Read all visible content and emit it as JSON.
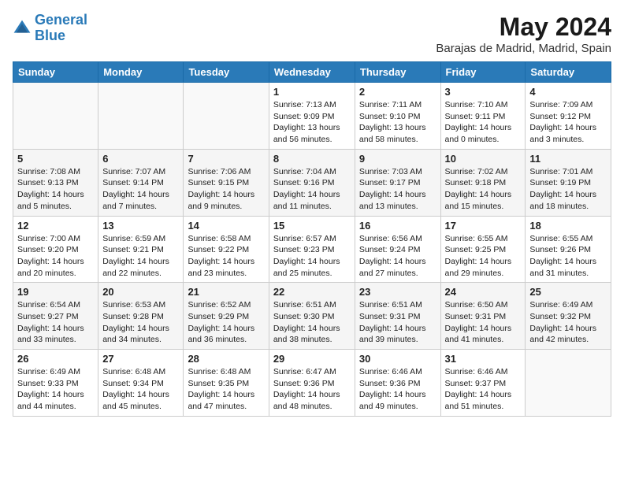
{
  "header": {
    "logo_general": "General",
    "logo_blue": "Blue",
    "month_year": "May 2024",
    "location": "Barajas de Madrid, Madrid, Spain"
  },
  "weekdays": [
    "Sunday",
    "Monday",
    "Tuesday",
    "Wednesday",
    "Thursday",
    "Friday",
    "Saturday"
  ],
  "weeks": [
    [
      {
        "day": "",
        "sunrise": "",
        "sunset": "",
        "daylight": ""
      },
      {
        "day": "",
        "sunrise": "",
        "sunset": "",
        "daylight": ""
      },
      {
        "day": "",
        "sunrise": "",
        "sunset": "",
        "daylight": ""
      },
      {
        "day": "1",
        "sunrise": "Sunrise: 7:13 AM",
        "sunset": "Sunset: 9:09 PM",
        "daylight": "Daylight: 13 hours and 56 minutes."
      },
      {
        "day": "2",
        "sunrise": "Sunrise: 7:11 AM",
        "sunset": "Sunset: 9:10 PM",
        "daylight": "Daylight: 13 hours and 58 minutes."
      },
      {
        "day": "3",
        "sunrise": "Sunrise: 7:10 AM",
        "sunset": "Sunset: 9:11 PM",
        "daylight": "Daylight: 14 hours and 0 minutes."
      },
      {
        "day": "4",
        "sunrise": "Sunrise: 7:09 AM",
        "sunset": "Sunset: 9:12 PM",
        "daylight": "Daylight: 14 hours and 3 minutes."
      }
    ],
    [
      {
        "day": "5",
        "sunrise": "Sunrise: 7:08 AM",
        "sunset": "Sunset: 9:13 PM",
        "daylight": "Daylight: 14 hours and 5 minutes."
      },
      {
        "day": "6",
        "sunrise": "Sunrise: 7:07 AM",
        "sunset": "Sunset: 9:14 PM",
        "daylight": "Daylight: 14 hours and 7 minutes."
      },
      {
        "day": "7",
        "sunrise": "Sunrise: 7:06 AM",
        "sunset": "Sunset: 9:15 PM",
        "daylight": "Daylight: 14 hours and 9 minutes."
      },
      {
        "day": "8",
        "sunrise": "Sunrise: 7:04 AM",
        "sunset": "Sunset: 9:16 PM",
        "daylight": "Daylight: 14 hours and 11 minutes."
      },
      {
        "day": "9",
        "sunrise": "Sunrise: 7:03 AM",
        "sunset": "Sunset: 9:17 PM",
        "daylight": "Daylight: 14 hours and 13 minutes."
      },
      {
        "day": "10",
        "sunrise": "Sunrise: 7:02 AM",
        "sunset": "Sunset: 9:18 PM",
        "daylight": "Daylight: 14 hours and 15 minutes."
      },
      {
        "day": "11",
        "sunrise": "Sunrise: 7:01 AM",
        "sunset": "Sunset: 9:19 PM",
        "daylight": "Daylight: 14 hours and 18 minutes."
      }
    ],
    [
      {
        "day": "12",
        "sunrise": "Sunrise: 7:00 AM",
        "sunset": "Sunset: 9:20 PM",
        "daylight": "Daylight: 14 hours and 20 minutes."
      },
      {
        "day": "13",
        "sunrise": "Sunrise: 6:59 AM",
        "sunset": "Sunset: 9:21 PM",
        "daylight": "Daylight: 14 hours and 22 minutes."
      },
      {
        "day": "14",
        "sunrise": "Sunrise: 6:58 AM",
        "sunset": "Sunset: 9:22 PM",
        "daylight": "Daylight: 14 hours and 23 minutes."
      },
      {
        "day": "15",
        "sunrise": "Sunrise: 6:57 AM",
        "sunset": "Sunset: 9:23 PM",
        "daylight": "Daylight: 14 hours and 25 minutes."
      },
      {
        "day": "16",
        "sunrise": "Sunrise: 6:56 AM",
        "sunset": "Sunset: 9:24 PM",
        "daylight": "Daylight: 14 hours and 27 minutes."
      },
      {
        "day": "17",
        "sunrise": "Sunrise: 6:55 AM",
        "sunset": "Sunset: 9:25 PM",
        "daylight": "Daylight: 14 hours and 29 minutes."
      },
      {
        "day": "18",
        "sunrise": "Sunrise: 6:55 AM",
        "sunset": "Sunset: 9:26 PM",
        "daylight": "Daylight: 14 hours and 31 minutes."
      }
    ],
    [
      {
        "day": "19",
        "sunrise": "Sunrise: 6:54 AM",
        "sunset": "Sunset: 9:27 PM",
        "daylight": "Daylight: 14 hours and 33 minutes."
      },
      {
        "day": "20",
        "sunrise": "Sunrise: 6:53 AM",
        "sunset": "Sunset: 9:28 PM",
        "daylight": "Daylight: 14 hours and 34 minutes."
      },
      {
        "day": "21",
        "sunrise": "Sunrise: 6:52 AM",
        "sunset": "Sunset: 9:29 PM",
        "daylight": "Daylight: 14 hours and 36 minutes."
      },
      {
        "day": "22",
        "sunrise": "Sunrise: 6:51 AM",
        "sunset": "Sunset: 9:30 PM",
        "daylight": "Daylight: 14 hours and 38 minutes."
      },
      {
        "day": "23",
        "sunrise": "Sunrise: 6:51 AM",
        "sunset": "Sunset: 9:31 PM",
        "daylight": "Daylight: 14 hours and 39 minutes."
      },
      {
        "day": "24",
        "sunrise": "Sunrise: 6:50 AM",
        "sunset": "Sunset: 9:31 PM",
        "daylight": "Daylight: 14 hours and 41 minutes."
      },
      {
        "day": "25",
        "sunrise": "Sunrise: 6:49 AM",
        "sunset": "Sunset: 9:32 PM",
        "daylight": "Daylight: 14 hours and 42 minutes."
      }
    ],
    [
      {
        "day": "26",
        "sunrise": "Sunrise: 6:49 AM",
        "sunset": "Sunset: 9:33 PM",
        "daylight": "Daylight: 14 hours and 44 minutes."
      },
      {
        "day": "27",
        "sunrise": "Sunrise: 6:48 AM",
        "sunset": "Sunset: 9:34 PM",
        "daylight": "Daylight: 14 hours and 45 minutes."
      },
      {
        "day": "28",
        "sunrise": "Sunrise: 6:48 AM",
        "sunset": "Sunset: 9:35 PM",
        "daylight": "Daylight: 14 hours and 47 minutes."
      },
      {
        "day": "29",
        "sunrise": "Sunrise: 6:47 AM",
        "sunset": "Sunset: 9:36 PM",
        "daylight": "Daylight: 14 hours and 48 minutes."
      },
      {
        "day": "30",
        "sunrise": "Sunrise: 6:46 AM",
        "sunset": "Sunset: 9:36 PM",
        "daylight": "Daylight: 14 hours and 49 minutes."
      },
      {
        "day": "31",
        "sunrise": "Sunrise: 6:46 AM",
        "sunset": "Sunset: 9:37 PM",
        "daylight": "Daylight: 14 hours and 51 minutes."
      },
      {
        "day": "",
        "sunrise": "",
        "sunset": "",
        "daylight": ""
      }
    ]
  ]
}
